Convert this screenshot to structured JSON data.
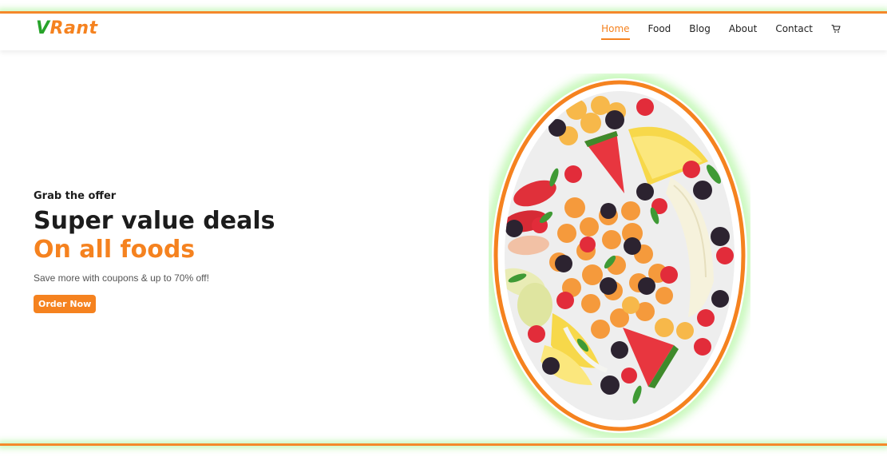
{
  "brand": {
    "logo_first": "V",
    "logo_rest": "Rant"
  },
  "nav": {
    "items": [
      {
        "label": "Home",
        "active": true
      },
      {
        "label": "Food",
        "active": false
      },
      {
        "label": "Blog",
        "active": false
      },
      {
        "label": "About",
        "active": false
      },
      {
        "label": "Contact",
        "active": false
      }
    ],
    "cart_icon": "cart-icon"
  },
  "hero": {
    "eyebrow": "Grab the offer",
    "headline": "Super value deals",
    "headline_accent": "On all foods",
    "subtext": "Save more with coupons & up to 70% off!",
    "cta_label": "Order Now",
    "image_alt": "fruit-salad-plate"
  },
  "colors": {
    "accent": "#f5821f",
    "brand_green": "#27a32a",
    "glow": "#96f082"
  }
}
